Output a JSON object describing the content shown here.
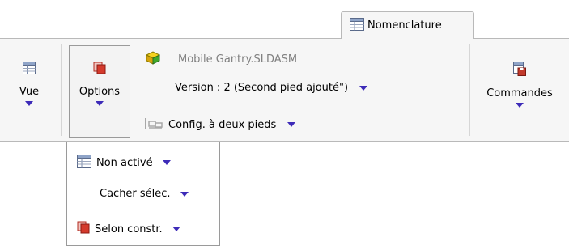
{
  "tab": {
    "label": "Nomenclature"
  },
  "toolbar": {
    "vue_label": "Vue",
    "options_label": "Options",
    "commandes_label": "Commandes"
  },
  "document": {
    "name": "Mobile Gantry.SLDASM",
    "version": "Version : 2 (Second pied ajouté\")",
    "config": "Config. à deux pieds"
  },
  "dropdown": {
    "items": [
      {
        "label": "Non activé",
        "icon": "table-icon"
      },
      {
        "label": "Cacher sélec.",
        "icon": ""
      },
      {
        "label": "Selon constr.",
        "icon": "copy-icon"
      }
    ]
  },
  "colors": {
    "arrow": "#3d2bb8",
    "border": "#b9b9b9",
    "ribbon_bg": "#f6f6f6"
  }
}
